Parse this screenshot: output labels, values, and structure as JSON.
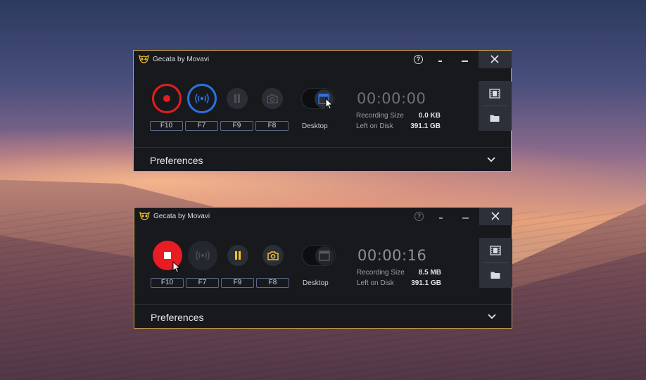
{
  "windows": [
    {
      "title": "Gecata by Movavi",
      "state": "idle",
      "hotkeys": [
        "F10",
        "F7",
        "F9",
        "F8"
      ],
      "source_label": "Desktop",
      "timer": "00:00:00",
      "recording_size_label": "Recording Size",
      "recording_size_value": "0.0 KB",
      "left_on_disk_label": "Left on Disk",
      "left_on_disk_value": "391.1 GB",
      "preferences_label": "Preferences"
    },
    {
      "title": "Gecata by Movavi",
      "state": "recording",
      "hotkeys": [
        "F10",
        "F7",
        "F9",
        "F8"
      ],
      "source_label": "Desktop",
      "timer": "00:00:16",
      "recording_size_label": "Recording Size",
      "recording_size_value": "8.5 MB",
      "left_on_disk_label": "Left on Disk",
      "left_on_disk_value": "391.1 GB",
      "preferences_label": "Preferences"
    }
  ],
  "icons": {
    "logo": "owl-logo-icon",
    "help": "help-icon",
    "minimize": "minimize-icon",
    "close": "close-icon",
    "record": "record-icon",
    "stop": "stop-icon",
    "stream": "broadcast-icon",
    "pause": "pause-icon",
    "screenshot": "camera-icon",
    "source_window": "window-icon",
    "videos": "film-icon",
    "folder": "folder-icon",
    "expand": "chevron-down-icon"
  },
  "colors": {
    "record_red": "#e0201f",
    "stream_blue": "#2b73e0",
    "accent_yellow": "#f2c12e",
    "border_gold": "#c9a24a",
    "window_bg": "#17191d"
  },
  "help_glyph": "?"
}
